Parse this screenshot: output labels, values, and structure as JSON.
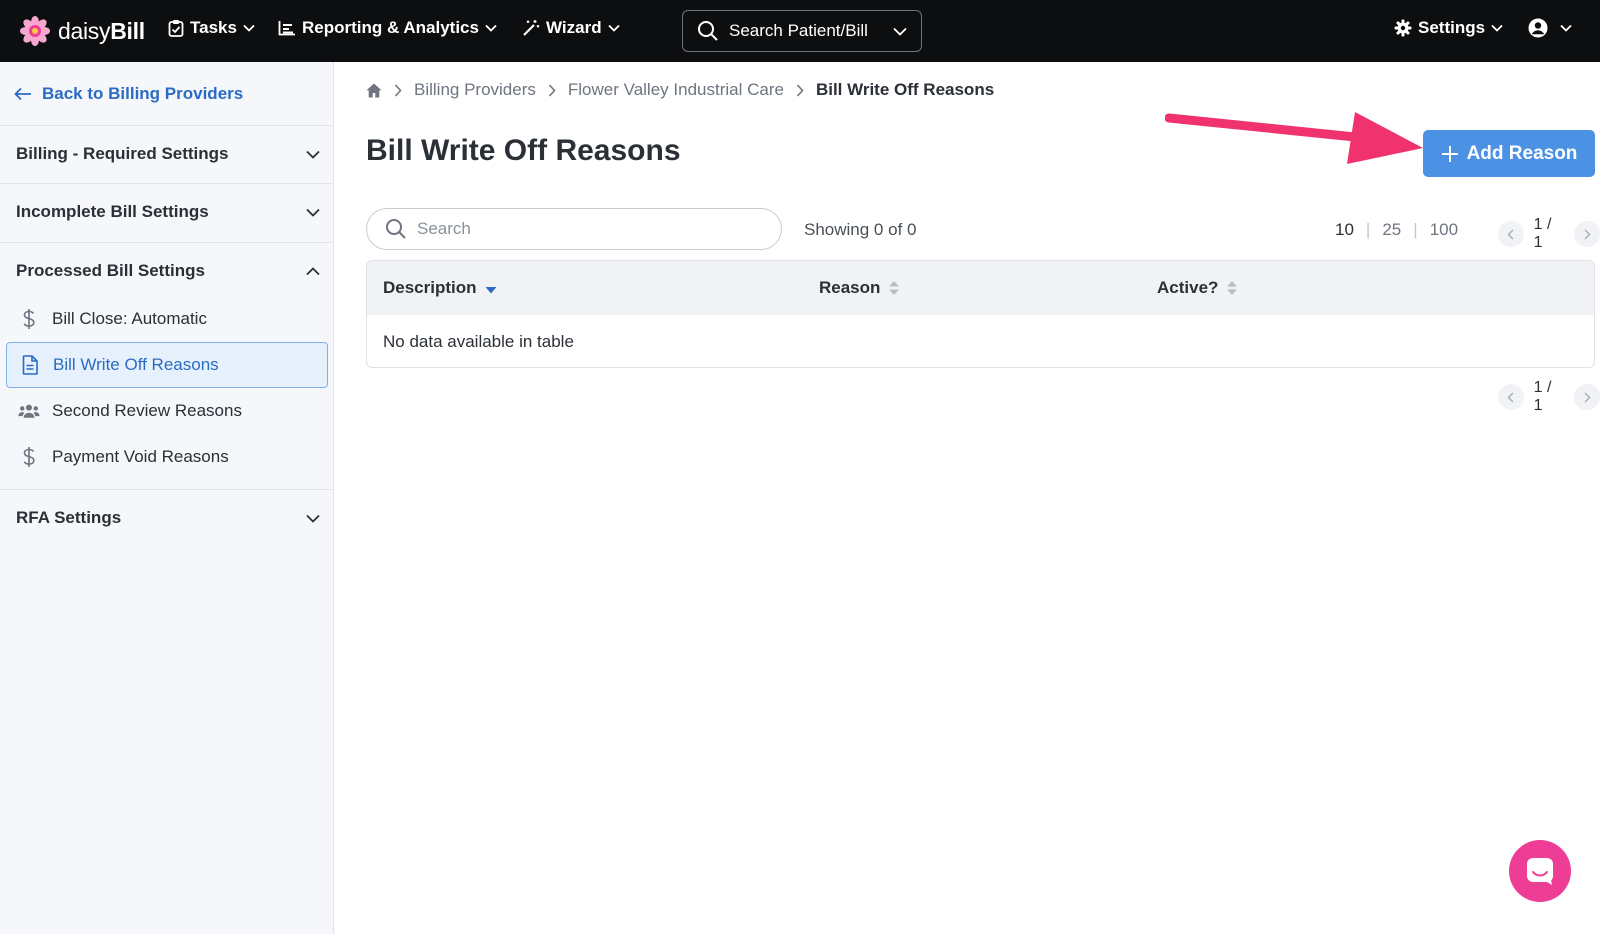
{
  "navbar": {
    "logo_light": "daisy",
    "logo_bold": "Bill",
    "items": [
      {
        "label": "Tasks"
      },
      {
        "label": "Reporting & Analytics"
      },
      {
        "label": "Wizard"
      }
    ],
    "search_label": "Search Patient/Bill",
    "settings_label": "Settings"
  },
  "sidebar": {
    "back_label": "Back to Billing Providers",
    "sections": [
      {
        "label": "Billing - Required Settings"
      },
      {
        "label": "Incomplete Bill Settings"
      },
      {
        "label": "Processed Bill Settings"
      },
      {
        "label": "RFA Settings"
      }
    ],
    "items": [
      {
        "label": "Bill Close: Automatic"
      },
      {
        "label": "Bill Write Off Reasons"
      },
      {
        "label": "Second Review Reasons"
      },
      {
        "label": "Payment Void Reasons"
      }
    ]
  },
  "breadcrumb": {
    "items": [
      "Billing Providers",
      "Flower Valley Industrial Care"
    ],
    "current": "Bill Write Off Reasons"
  },
  "page": {
    "title": "Bill Write Off Reasons",
    "add_button": "Add Reason"
  },
  "table_controls": {
    "search_placeholder": "Search",
    "showing": "Showing 0 of 0",
    "page_sizes": [
      "10",
      "25",
      "100"
    ],
    "page_indicator": "1 / 1"
  },
  "table": {
    "columns": [
      "Description",
      "Reason",
      "Active?"
    ],
    "empty_message": "No data available in table"
  },
  "colors": {
    "navbar": "#0d0e10",
    "accent": "#4c92e4",
    "link": "#2a6cc4",
    "annotation_arrow": "#f0336f",
    "chat": "#ee3d95"
  }
}
